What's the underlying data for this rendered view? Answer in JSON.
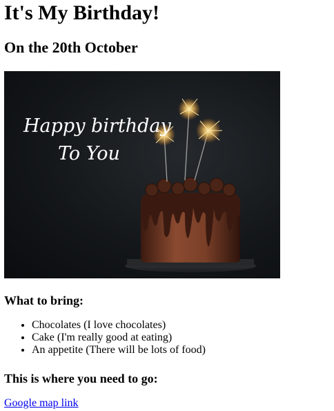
{
  "page": {
    "title": "It's My Birthday!",
    "subtitle": "On the 20th October"
  },
  "hero_image": {
    "script_text_line1": "Happy birthday",
    "script_text_line2": "To You",
    "colors": {
      "background": "#121518",
      "script_text": "#ffffff",
      "cake": "#7a3f2a",
      "frosting": "#3a1a10",
      "spark": "#ffd27a"
    }
  },
  "bring_section": {
    "heading": "What to bring:",
    "items": [
      "Chocolates (I love chocolates)",
      "Cake (I'm really good at eating)",
      "An appetite (There will be lots of food)"
    ]
  },
  "directions_section": {
    "heading": "This is where you need to go:",
    "link_text": "Google map link"
  },
  "colors": {
    "link": "#0000ee",
    "text": "#000000",
    "background": "#ffffff"
  }
}
